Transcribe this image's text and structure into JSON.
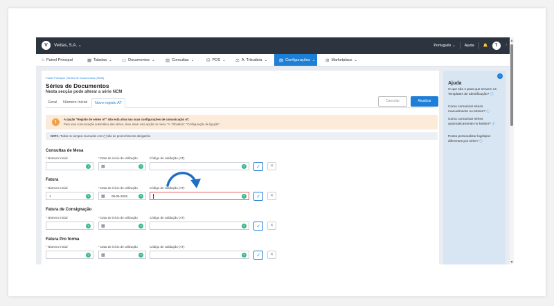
{
  "topbar": {
    "logo": "V",
    "company": "Veritas, S.A.",
    "language": "Português",
    "help": "Ajuda",
    "avatar": "T"
  },
  "nav": {
    "items": [
      {
        "label": "Painel Principal",
        "icon": "home-icon"
      },
      {
        "label": "Tabelas",
        "icon": "table-icon"
      },
      {
        "label": "Documentos",
        "icon": "document-icon"
      },
      {
        "label": "Consultas",
        "icon": "chart-icon"
      },
      {
        "label": "POS",
        "icon": "pos-icon"
      },
      {
        "label": "A. Tributária",
        "icon": "balance-icon"
      },
      {
        "label": "Configurações",
        "icon": "settings-icon",
        "active": true
      },
      {
        "label": "Marketplace",
        "icon": "marketplace-icon"
      }
    ]
  },
  "page": {
    "breadcrumb": "Painel Principal  |  Séries de Documentos (NCM)",
    "title": "Séries de Documentos",
    "subtitle": "Nesta secção pode alterar a série NCM",
    "tabs": [
      "Geral",
      "Número Inicial",
      "Novo registo AT"
    ],
    "active_tab": "Novo registo AT",
    "cancel_label": "Cancelar",
    "update_label": "Atualizar"
  },
  "warning": {
    "line1": "A opção \"Registo de séries AT\" não está ativa nas suas configurações de comunicação AT.",
    "line2": "Para uma comunicação automática das séries, deve ativar esta opção no menu \"A. Tributária\", \"Configuração de ligação\"."
  },
  "note": {
    "bold": "NOTA:",
    "text": " Todos os campos marcados com (*) são de preenchimento obrigatório"
  },
  "labels": {
    "numero_inicial": "Número inicial",
    "data_inicio": "Data de início de utilização",
    "codigo": "Código de validação (AT)",
    "required_mark": "*"
  },
  "sections": [
    {
      "title": "Consultas de Mesa",
      "numero": "",
      "data": "",
      "codigo": ""
    },
    {
      "title": "Fatura",
      "numero": "1",
      "data": "08-05-2026",
      "codigo": ""
    },
    {
      "title": "Fatura de Consignação",
      "numero": "",
      "data": "",
      "codigo": ""
    },
    {
      "title": "Fatura Pro forma",
      "numero": "",
      "data": "",
      "codigo": ""
    }
  ],
  "help": {
    "title": "Ajuda",
    "items": [
      "O que são e para que servem os Templates de Identificação?",
      "Como comunicar séries manualmente no Moloni?",
      "Como comunicar séries automaticamente no Moloni?",
      "Posso personalizar logótipos diferentes por série?"
    ]
  },
  "colors": {
    "topbar": "#2c3440",
    "accent": "#1e7fd6",
    "warning_bg": "#fdebd9",
    "warning_icon": "#f0a24a",
    "success": "#3db88b",
    "help_bg": "#d8e5f3"
  }
}
